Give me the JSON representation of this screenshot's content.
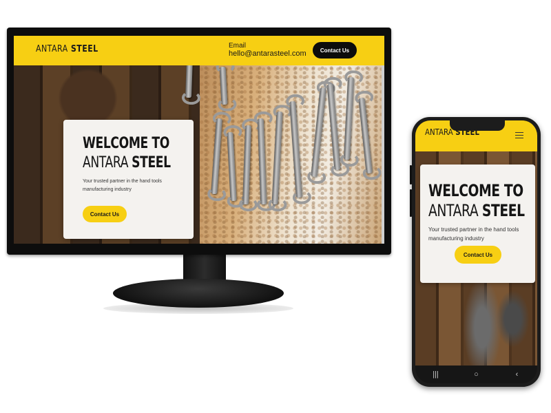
{
  "desktop": {
    "header": {
      "logo_prefix": "ANTARA",
      "logo_suffix": "STEEL",
      "email_label": "Email",
      "email": "hello@antarasteel.com",
      "contact_button": "Contact Us"
    },
    "hero": {
      "title_line1": "WELCOME TO",
      "title_line2_prefix": "ANTARA",
      "title_line2_suffix": "STEEL",
      "subtitle": "Your trusted partner in the hand tools manufacturing industry",
      "button": "Contact Us"
    }
  },
  "mobile": {
    "header": {
      "logo_prefix": "ANTARA",
      "logo_suffix": "STEEL",
      "menu_icon": "hamburger-menu-icon"
    },
    "hero": {
      "title_line1": "WELCOME TO",
      "title_line2_prefix": "ANTARA",
      "title_line2_suffix": "STEEL",
      "subtitle": "Your trusted partner in the hand tools manufacturing industry",
      "button": "Contact Us"
    },
    "navbar": {
      "recent_icon": "|||",
      "home_icon": "○",
      "back_icon": "‹"
    }
  },
  "colors": {
    "brand_yellow": "#f7cf13",
    "dark": "#0c0c0c",
    "card": "#f4f2ef"
  }
}
